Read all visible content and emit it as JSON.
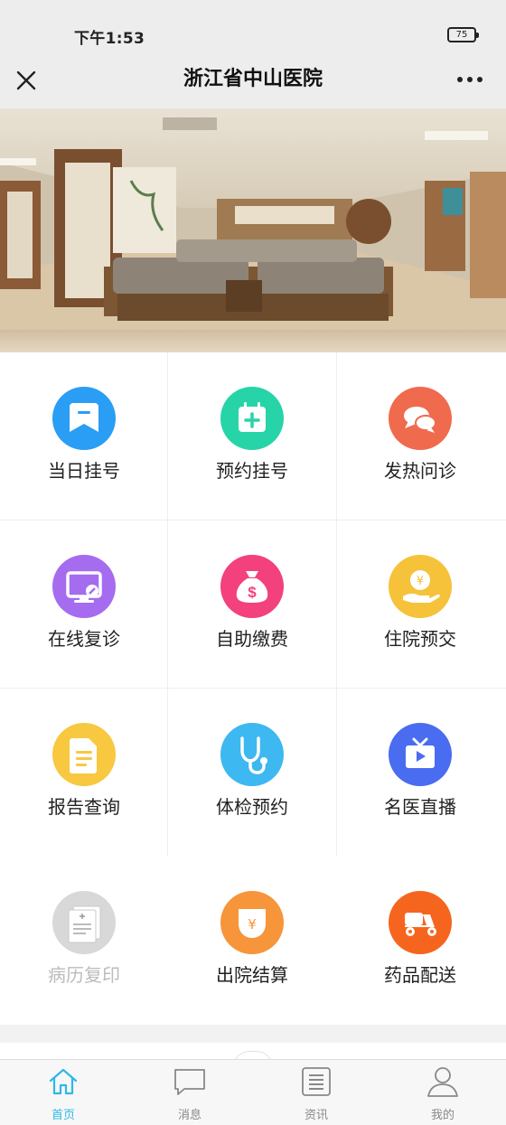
{
  "status_bar": {
    "time": "下午1:53",
    "battery": "75"
  },
  "nav": {
    "title": "浙江省中山医院"
  },
  "banner": {
    "alt": "hospital-waiting-hall-photo"
  },
  "services": [
    {
      "label": "当日挂号",
      "icon": "bookmark-icon",
      "color": "#2a9df4"
    },
    {
      "label": "预约挂号",
      "icon": "calendar-plus-icon",
      "color": "#26d4a8"
    },
    {
      "label": "发热问诊",
      "icon": "chat-bubbles-icon",
      "color": "#f06a4e"
    },
    {
      "label": "在线复诊",
      "icon": "monitor-icon",
      "color": "#a56cf0"
    },
    {
      "label": "自助缴费",
      "icon": "money-bag-icon",
      "color": "#f2417c"
    },
    {
      "label": "住院预交",
      "icon": "coin-hand-icon",
      "color": "#f5c23a"
    },
    {
      "label": "报告查询",
      "icon": "document-icon",
      "color": "#f7c840"
    },
    {
      "label": "体检预约",
      "icon": "stethoscope-icon",
      "color": "#3db8f0"
    },
    {
      "label": "名医直播",
      "icon": "tv-play-icon",
      "color": "#4a6cf0"
    },
    {
      "label": "病历复印",
      "icon": "medical-record-icon",
      "color": "#d8d8d8",
      "disabled": true
    },
    {
      "label": "出院结算",
      "icon": "yuan-wallet-icon",
      "color": "#f7953a"
    },
    {
      "label": "药品配送",
      "icon": "delivery-scooter-icon",
      "color": "#f5651e"
    }
  ],
  "tabs": [
    {
      "label": "首页",
      "icon": "home-icon",
      "active": true
    },
    {
      "label": "消息",
      "icon": "message-icon",
      "active": false
    },
    {
      "label": "资讯",
      "icon": "news-icon",
      "active": false
    },
    {
      "label": "我的",
      "icon": "user-icon",
      "active": false
    }
  ],
  "colors": {
    "accent": "#2eb8e8",
    "background": "#ededed"
  }
}
